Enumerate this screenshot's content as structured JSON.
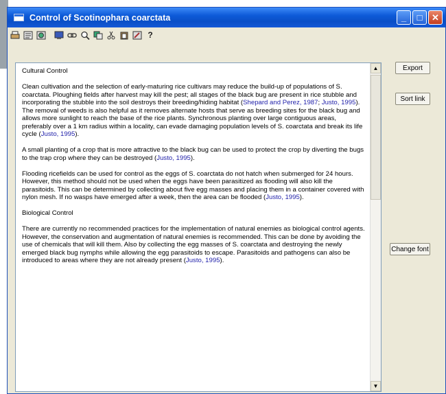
{
  "window": {
    "title": "Control of Scotinophara coarctata",
    "minimize_glyph": "_",
    "maximize_glyph": "□",
    "close_glyph": "✕"
  },
  "toolbar": {
    "icons": [
      "print-icon",
      "page-icon",
      "globe-icon",
      "monitor-icon",
      "link-icon",
      "zoom-icon",
      "copy-icon",
      "cut-icon",
      "paste-icon",
      "edit-icon",
      "help-icon"
    ],
    "help_label": "?"
  },
  "buttons": {
    "export": "Export",
    "sort_link": "Sort link",
    "change_font": "Change font"
  },
  "content": {
    "heading_cultural": "Cultural Control",
    "p1_text": "Clean cultivation and the selection of early-maturing rice cultivars may reduce the build-up of populations of S. coarctata. Ploughing fields after harvest may kill the pest; all stages of the black bug are present in rice stubble and incorporating the stubble into the soil destroys their breeding/hiding habitat (",
    "p1_ref1": "Shepard and Perez, 1987",
    "p1_sep": "; ",
    "p1_ref2": "Justo, 1995",
    "p1_text2": "). The removal of weeds is also helpful as it removes alternate hosts that serve as breeding sites for the black bug and allows more sunlight to reach the base of the rice plants. Synchronous planting over large contiguous areas, preferably over a 1 km radius within a locality, can evade damaging population levels of S. coarctata and break its life cycle (",
    "p1_ref3": "Justo, 1995",
    "p1_end": ").",
    "p2_text": "A small planting of a crop that is more attractive to the black bug can be used to protect the crop by diverting the bugs to the trap crop where they can be destroyed (",
    "p2_ref": "Justo, 1995",
    "p2_end": ").",
    "p3_text": "Flooding ricefields can be used for control as the eggs of S. coarctata do not hatch when submerged for 24 hours. However, this method should not be used when the eggs have been parasitized as flooding will also kill the parasitoids. This can be determined by collecting about five egg masses and placing them in a container covered with nylon mesh. If no wasps have emerged after a week, then the area can be flooded (",
    "p3_ref": "Justo, 1995",
    "p3_end": ").",
    "heading_biological": "Biological Control",
    "p4_text": "There are currently no recommended practices for the implementation of natural enemies as biological control agents. However, the conservation and augmentation of natural enemies is recommended. This can be done by avoiding the use of chemicals that will kill them. Also by collecting the egg masses of S. coarctata and destroying the newly emerged black bug nymphs while allowing the egg parasitoids to escape. Parasitoids and pathogens can also be introduced to areas where they are not already present (",
    "p4_ref": "Justo, 1995",
    "p4_end": ")."
  },
  "scrollbar": {
    "up_glyph": "▲",
    "down_glyph": "▼"
  }
}
